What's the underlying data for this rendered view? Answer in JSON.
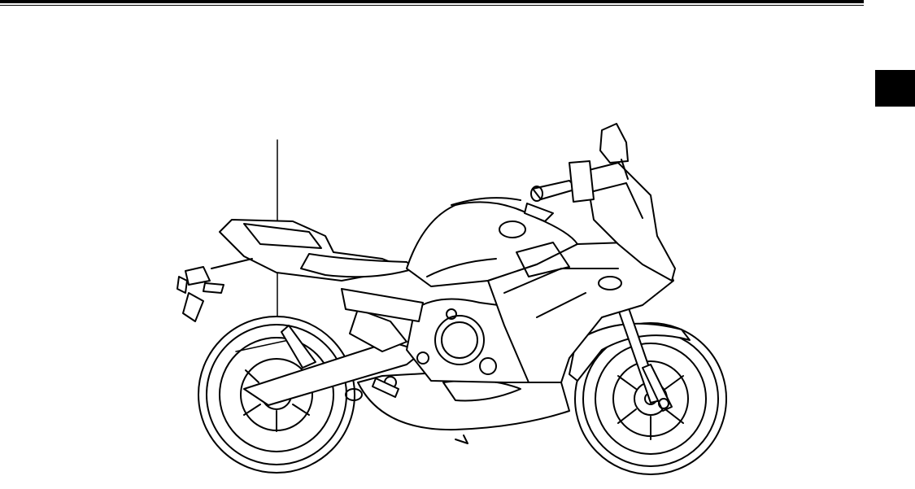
{
  "page": {
    "header_rules": "double",
    "section_tab_color": "#000000",
    "illustration": {
      "subject": "motorcycle-left-side-line-drawing",
      "stroke_color": "#000000",
      "fill_color": "#ffffff"
    }
  }
}
